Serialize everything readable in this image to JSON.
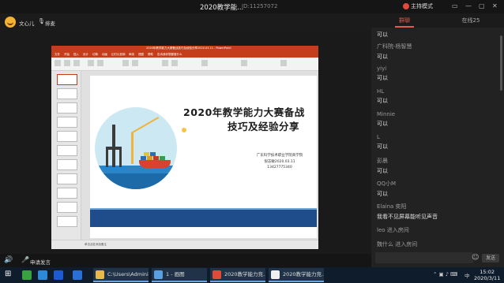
{
  "window": {
    "title": "2020教学能...",
    "meeting_id": "ID:11257072",
    "host_mode": "主持模式",
    "controls": [
      "▭",
      "—",
      "▢",
      "✕"
    ]
  },
  "host": {
    "name": "文心儿",
    "sort_label": "排麦"
  },
  "powerpoint": {
    "title_text": "2020年教学能力大赛备战技巧及经验分享2020.03.11 - PowerPoint",
    "tabs": [
      "文件",
      "开始",
      "插入",
      "设计",
      "切换",
      "动画",
      "幻灯片放映",
      "审阅",
      "视图",
      "帮助",
      "告诉我你想要做什么"
    ],
    "status": "单击此处添加备注",
    "slide": {
      "title_line1": "2020年教学能力大赛备战",
      "title_line2": "技巧及经验分享",
      "org": "广东科学技术职业学院商学院",
      "presenter": "倪志敏2020.03.11",
      "phone": "13427775340"
    }
  },
  "client_bar": {
    "speaker_icon": "🔊",
    "mic_icon": "🎤",
    "apply_label": "申请发言"
  },
  "chat": {
    "tabs": [
      {
        "label": "群聊",
        "active": true
      },
      {
        "label": "在线25",
        "active": false
      }
    ],
    "messages": [
      {
        "name": "",
        "text": "可以"
      },
      {
        "name": "广科院-杨智慧",
        "text": "可以"
      },
      {
        "name": "yiyi",
        "text": "可以"
      },
      {
        "name": "HL",
        "text": "可以"
      },
      {
        "name": "Minnie",
        "text": "可以"
      },
      {
        "name": "L",
        "text": "可以"
      },
      {
        "name": "彭晨",
        "text": "可以"
      },
      {
        "name": "QQ小M",
        "text": "可以"
      },
      {
        "name": "Elaina 奕阳",
        "text": "我看不见屏幕能听见声音"
      }
    ],
    "system": [
      "leo 进入房间",
      "魏什么 进入房间"
    ],
    "emoji_icon": "☺",
    "send_label": "发送"
  },
  "taskbar": {
    "items": [
      {
        "label": "C:\\Users\\Admini...",
        "color": "#e8b84a"
      },
      {
        "label": "1 - 画图",
        "color": "#5aa0e0"
      },
      {
        "label": "2020教学能力竞...",
        "color": "#e04a3a"
      },
      {
        "label": "2020教学能力竞...",
        "color": "#f0f0f0"
      }
    ],
    "tray_lang": "中",
    "tray_icons": "⌃ ▣ ♪ ⌨",
    "time": "15:02",
    "date": "2020/3/11"
  }
}
